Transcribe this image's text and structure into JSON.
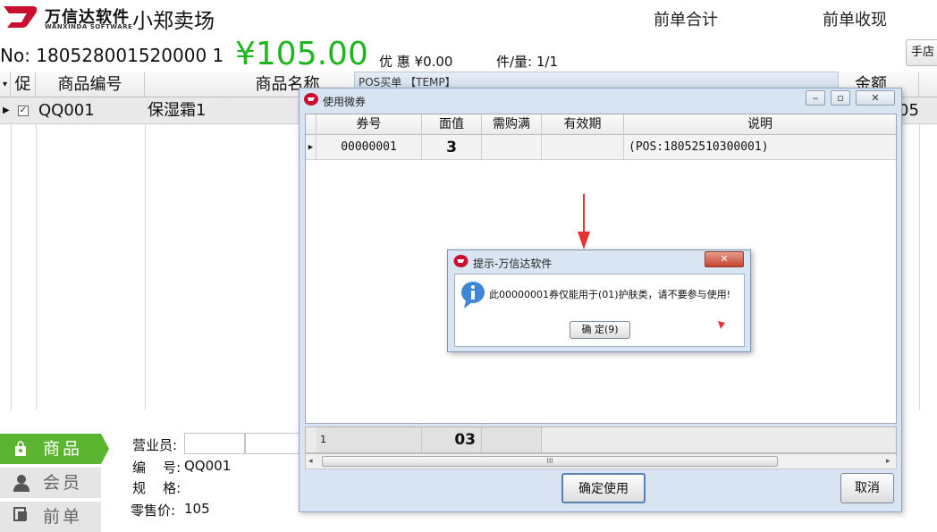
{
  "app": {
    "brand_cn": "万信达软件",
    "brand_en": "WANXINDA SOFTWARE",
    "store_name": "小郑卖场",
    "prev_total_label": "前单合计",
    "prev_received_label": "前单收现",
    "manual_btn": "手店",
    "brand_color": "#c8102e",
    "accent_green": "#1fb51f"
  },
  "order": {
    "number": "No: 180528001520000 1",
    "total": "¥105.00",
    "discount": "优 惠 ¥0.00",
    "qty": "件/量:  1/1"
  },
  "grid": {
    "headers": [
      "促",
      "商品编号",
      "商品名称",
      "金额"
    ],
    "rows": [
      {
        "promo": "✓",
        "code": "QQ001",
        "name": "保湿霜1",
        "amount": "05"
      }
    ]
  },
  "bottom": {
    "tabs": [
      "商品",
      "会员",
      "前单"
    ],
    "sales_label": "营业员:",
    "code_label": "编    号:",
    "code_value": "QQ001",
    "spec_label": "规    格:",
    "price_label": "零售价:",
    "price_value": "105"
  },
  "pos_strip": {
    "title": "POS买单 【TEMP】"
  },
  "coupon_window": {
    "title": "使用微券",
    "headers": [
      "券号",
      "面值",
      "需购满",
      "有效期",
      "说明"
    ],
    "rows": [
      {
        "no": "00000001",
        "value": "3",
        "min": "",
        "expire": "",
        "desc": "(POS:18052510300001)"
      }
    ],
    "footer_count": "1",
    "footer_total": "03",
    "confirm_btn": "确定使用",
    "cancel_btn": "取消",
    "scroll_grip": "III"
  },
  "alert": {
    "title": "提示-万信达软件",
    "message": "此00000001券仅能用于(01)护肤类，请不要参与使用!",
    "ok_btn": "确 定(9)"
  }
}
